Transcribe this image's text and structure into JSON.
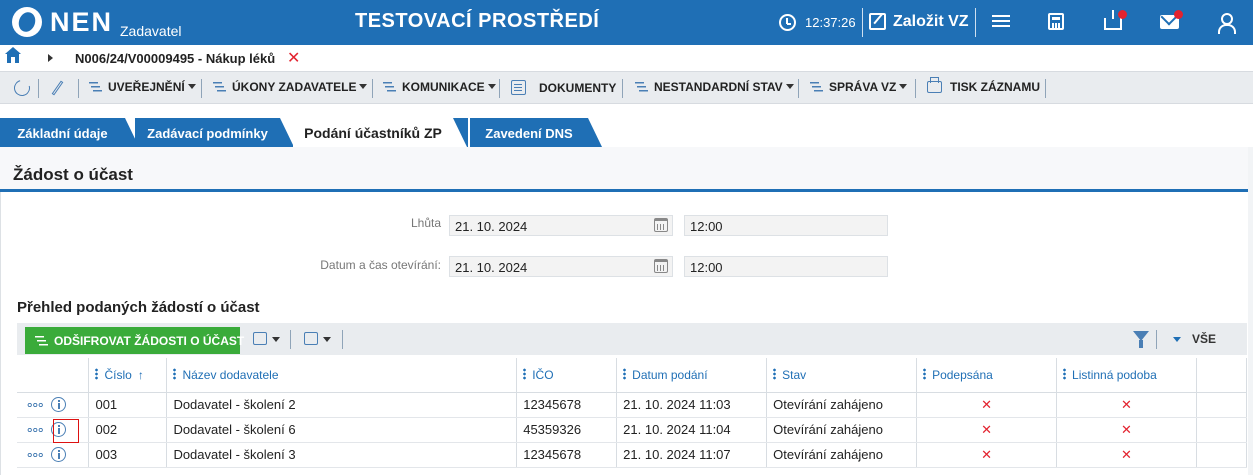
{
  "header": {
    "logo_main": "NEN",
    "logo_sub": "Zadavatel",
    "environment_title": "TESTOVACÍ PROSTŘEDÍ",
    "clock": "12:37:26",
    "create_label": "Založit VZ",
    "icons": [
      "clock-icon",
      "edit-icon",
      "menu-icon",
      "calculator-icon",
      "inbox-icon",
      "mail-icon",
      "user-icon"
    ],
    "notification_color": "#e3232f",
    "brand_color": "#1f6fb5"
  },
  "breadcrumb": {
    "text": "N006/24/V00009495 - Nákup léků",
    "close": "✕"
  },
  "toolbar": {
    "items": [
      {
        "label": "UVEŘEJNĚNÍ"
      },
      {
        "label": "ÚKONY ZADAVATELE"
      },
      {
        "label": "KOMUNIKACE"
      },
      {
        "label": "DOKUMENTY"
      },
      {
        "label": "NESTANDARDNÍ STAV"
      },
      {
        "label": "SPRÁVA VZ"
      },
      {
        "label": "TISK ZÁZNAMU"
      }
    ]
  },
  "tabs": [
    {
      "label": "Základní údaje"
    },
    {
      "label": "Zadávací podmínky"
    },
    {
      "label": "Podání účastníků ZP",
      "active": true
    },
    {
      "label": "Zavedení DNS"
    }
  ],
  "section": {
    "title": "Žádost o účast",
    "fields": [
      {
        "label": "Lhůta",
        "date": "21. 10. 2024",
        "time": "12:00"
      },
      {
        "label": "Datum a čas otevírání:",
        "date": "21. 10. 2024",
        "time": "12:00"
      }
    ]
  },
  "grid": {
    "title": "Přehled podaných žádostí o účast",
    "primary_button": "ODŠIFROVAT ŽÁDOSTI O ÚČAST",
    "filter_label": "VŠE",
    "columns": [
      "Číslo",
      "Název dodavatele",
      "IČO",
      "Datum podání",
      "Stav",
      "Podepsána",
      "Listinná podoba"
    ],
    "sort_indicator": "↑",
    "rows": [
      {
        "cislo": "001",
        "nazev": "Dodavatel - školení 2",
        "ico": "12345678",
        "datum": "21. 10. 2024 11:03",
        "stav": "Otevírání zahájeno",
        "podepsana": "✕",
        "listinna": "✕"
      },
      {
        "cislo": "002",
        "nazev": "Dodavatel - školení 6",
        "ico": "45359326",
        "datum": "21. 10. 2024 11:04",
        "stav": "Otevírání zahájeno",
        "podepsana": "✕",
        "listinna": "✕"
      },
      {
        "cislo": "003",
        "nazev": "Dodavatel - školení 3",
        "ico": "12345678",
        "datum": "21. 10. 2024 11:07",
        "stav": "Otevírání zahájeno",
        "podepsana": "✕",
        "listinna": "✕"
      }
    ]
  }
}
